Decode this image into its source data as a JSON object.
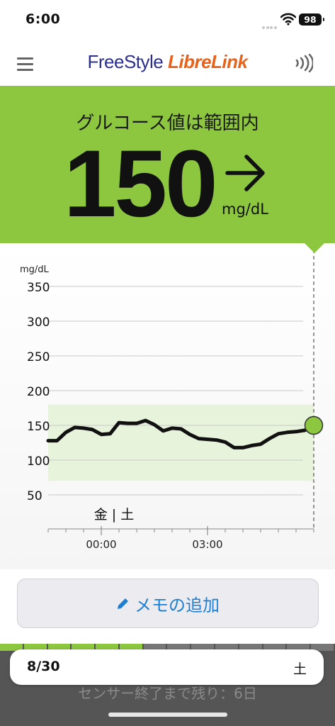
{
  "status_bar": {
    "time": "6:00",
    "battery": "98"
  },
  "header": {
    "brand_part1": "FreeStyle ",
    "brand_part2": "LibreLink"
  },
  "glucose": {
    "status": "グルコース値は範囲内",
    "value": "150",
    "unit": "mg/dL",
    "trend": "steady",
    "panel_color": "#8dc63f"
  },
  "chart_data": {
    "type": "line",
    "unit_label": "mg/dL",
    "y_ticks": [
      "350",
      "300",
      "250",
      "200",
      "150",
      "100",
      "50"
    ],
    "ylim": [
      0,
      360
    ],
    "target_range": [
      70,
      180
    ],
    "x_ticks": [
      "00:00",
      "03:00"
    ],
    "day_label": "金 | 土",
    "xlim": [
      "-01:30",
      "06:00"
    ],
    "series": [
      {
        "x": [
          "-01:30",
          "-01:15",
          "-01:00",
          "-00:45",
          "-00:30",
          "-00:15",
          "00:00",
          "00:15",
          "00:30",
          "00:45",
          "01:00",
          "01:15",
          "01:30",
          "01:45",
          "02:00",
          "02:15",
          "02:30",
          "02:45",
          "03:00",
          "03:15",
          "03:30",
          "03:45",
          "04:00",
          "04:15",
          "04:30",
          "04:45",
          "05:00",
          "05:15",
          "05:30",
          "05:45",
          "06:00"
        ],
        "values": [
          128,
          128,
          140,
          147,
          146,
          144,
          137,
          138,
          154,
          153,
          153,
          157,
          151,
          142,
          146,
          145,
          137,
          131,
          130,
          129,
          126,
          118,
          118,
          121,
          123,
          131,
          138,
          140,
          141,
          143,
          150
        ]
      }
    ],
    "current_marker": 150
  },
  "memo_button": {
    "label": "メモの追加"
  },
  "bottom": {
    "date": "8/30",
    "day": "土",
    "sensor_status": "センサー終了まで残り：6日",
    "sensor_days_total": 14,
    "sensor_days_remaining": 6
  }
}
